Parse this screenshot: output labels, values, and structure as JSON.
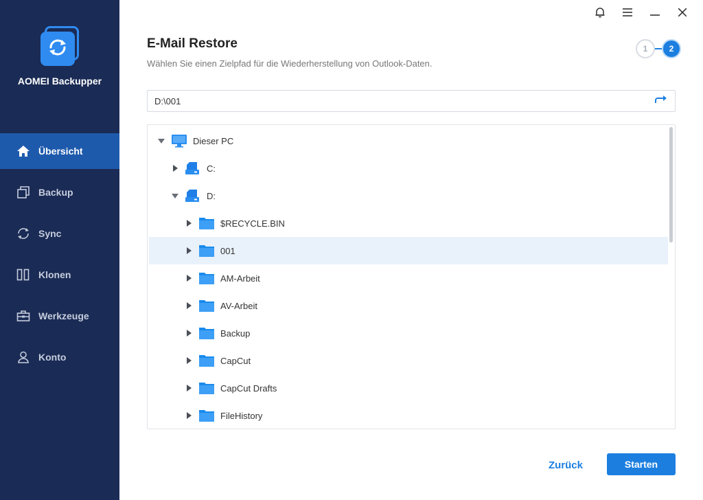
{
  "app": {
    "name": "AOMEI Backupper"
  },
  "colors": {
    "sidebar_bg": "#1a2b55",
    "sidebar_active": "#1e5aac",
    "accent": "#1c7fe0",
    "folder": "#1a8bec"
  },
  "sidebar": {
    "items": [
      {
        "label": "Übersicht",
        "icon": "home-icon",
        "active": true
      },
      {
        "label": "Backup",
        "icon": "backup-icon",
        "active": false
      },
      {
        "label": "Sync",
        "icon": "sync-icon",
        "active": false
      },
      {
        "label": "Klonen",
        "icon": "clone-icon",
        "active": false
      },
      {
        "label": "Werkzeuge",
        "icon": "toolbox-icon",
        "active": false
      },
      {
        "label": "Konto",
        "icon": "user-icon",
        "active": false
      }
    ]
  },
  "window_controls": [
    "bell-icon",
    "menu-icon",
    "minimize-icon",
    "close-icon"
  ],
  "header": {
    "title": "E-Mail Restore",
    "subtitle": "Wählen Sie einen Zielpfad für die Wiederherstellung von Outlook-Daten."
  },
  "steps": {
    "step1": "1",
    "step2": "2",
    "current": 2
  },
  "path": {
    "value": "D:\\001"
  },
  "tree": {
    "nodes": [
      {
        "label": "Dieser PC",
        "type": "pc",
        "depth": 0,
        "expanded": true
      },
      {
        "label": "C:",
        "type": "drive",
        "depth": 1,
        "expanded": false
      },
      {
        "label": "D:",
        "type": "drive",
        "depth": 1,
        "expanded": true
      },
      {
        "label": "$RECYCLE.BIN",
        "type": "folder",
        "depth": 2,
        "expanded": false
      },
      {
        "label": "001",
        "type": "folder",
        "depth": 2,
        "expanded": false,
        "selected": true
      },
      {
        "label": "AM-Arbeit",
        "type": "folder",
        "depth": 2,
        "expanded": false
      },
      {
        "label": "AV-Arbeit",
        "type": "folder",
        "depth": 2,
        "expanded": false
      },
      {
        "label": "Backup",
        "type": "folder",
        "depth": 2,
        "expanded": false
      },
      {
        "label": "CapCut",
        "type": "folder",
        "depth": 2,
        "expanded": false
      },
      {
        "label": "CapCut Drafts",
        "type": "folder",
        "depth": 2,
        "expanded": false
      },
      {
        "label": "FileHistory",
        "type": "folder",
        "depth": 2,
        "expanded": false
      }
    ]
  },
  "footer": {
    "back_label": "Zurück",
    "start_label": "Starten"
  }
}
